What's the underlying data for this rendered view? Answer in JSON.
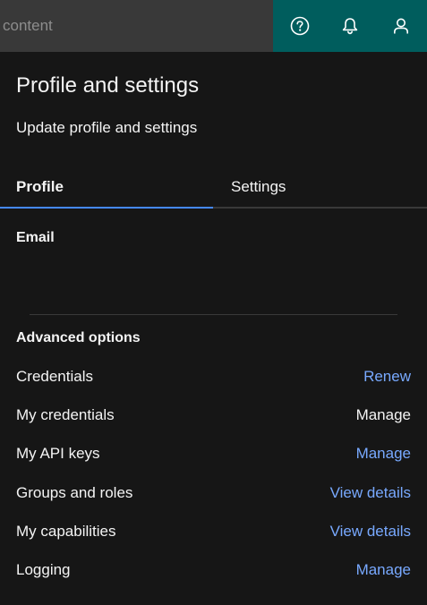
{
  "header": {
    "search_text": "content",
    "help_icon": "help-circle-icon",
    "notification_icon": "bell-icon",
    "user_icon": "user-icon",
    "actions_bg": "#005d5d"
  },
  "panel": {
    "title": "Profile and settings",
    "subtitle": "Update profile and settings",
    "tabs": [
      {
        "label": "Profile",
        "selected": true
      },
      {
        "label": "Settings",
        "selected": false
      }
    ],
    "email_heading": "Email",
    "advanced_heading": "Advanced options",
    "rows": [
      {
        "label": "Credentials",
        "action": "Renew",
        "link": true
      },
      {
        "label": "My credentials",
        "action": "Manage",
        "link": false
      },
      {
        "label": "My API keys",
        "action": "Manage",
        "link": true
      },
      {
        "label": "Groups and roles",
        "action": "View details",
        "link": true
      },
      {
        "label": "My capabilities",
        "action": "View details",
        "link": true
      },
      {
        "label": "Logging",
        "action": "Manage",
        "link": true
      }
    ],
    "colors": {
      "accent": "#4589ff",
      "link": "#78a9ff"
    }
  }
}
